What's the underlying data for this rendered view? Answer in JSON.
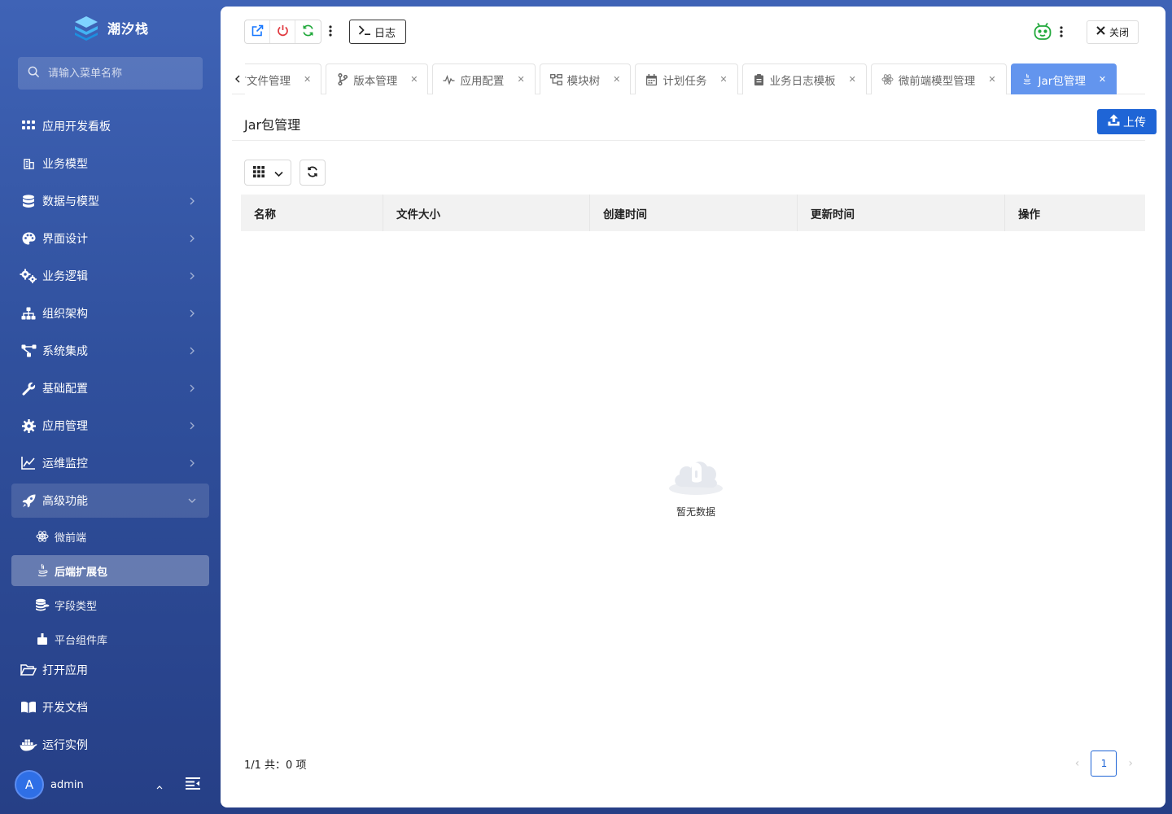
{
  "app": {
    "name": "潮汐栈"
  },
  "sidebar": {
    "search_placeholder": "请输入菜单名称",
    "items": [
      {
        "label": "应用开发看板",
        "icon": "grid-icon",
        "has_children": false
      },
      {
        "label": "业务模型",
        "icon": "building-icon",
        "has_children": false
      },
      {
        "label": "数据与模型",
        "icon": "database-icon",
        "has_children": true
      },
      {
        "label": "界面设计",
        "icon": "palette-icon",
        "has_children": true
      },
      {
        "label": "业务逻辑",
        "icon": "gears-icon",
        "has_children": true
      },
      {
        "label": "组织架构",
        "icon": "org-chart-icon",
        "has_children": true
      },
      {
        "label": "系统集成",
        "icon": "network-icon",
        "has_children": true
      },
      {
        "label": "基础配置",
        "icon": "wrench-icon",
        "has_children": true
      },
      {
        "label": "应用管理",
        "icon": "gear-icon",
        "has_children": true
      },
      {
        "label": "运维监控",
        "icon": "line-chart-icon",
        "has_children": true
      },
      {
        "label": "高级功能",
        "icon": "rocket-icon",
        "has_children": true,
        "expanded": true
      }
    ],
    "sub_items": [
      {
        "label": "微前端",
        "icon": "atom-icon"
      },
      {
        "label": "后端扩展包",
        "icon": "java-icon",
        "active": true
      },
      {
        "label": "字段类型",
        "icon": "coins-icon"
      },
      {
        "label": "平台组件库",
        "icon": "puzzle-icon"
      }
    ],
    "bottom_items": [
      {
        "label": "打开应用",
        "icon": "folder-open-icon"
      },
      {
        "label": "开发文档",
        "icon": "book-icon"
      },
      {
        "label": "运行实例",
        "icon": "docker-icon"
      }
    ],
    "user": {
      "avatar_letter": "A",
      "name": "admin"
    }
  },
  "toolbar": {
    "log_label": "日志",
    "close_label": "关闭"
  },
  "tabs": [
    {
      "label": "语言文件管理",
      "icon": "file-icon"
    },
    {
      "label": "版本管理",
      "icon": "branch-icon"
    },
    {
      "label": "应用配置",
      "icon": "pulse-icon"
    },
    {
      "label": "模块树",
      "icon": "tree-icon"
    },
    {
      "label": "计划任务",
      "icon": "calendar-icon"
    },
    {
      "label": "业务日志模板",
      "icon": "clipboard-icon"
    },
    {
      "label": "微前端模型管理",
      "icon": "atom-icon"
    },
    {
      "label": "Jar包管理",
      "icon": "java-icon",
      "active": true
    }
  ],
  "page": {
    "title": "Jar包管理",
    "upload_label": "上传",
    "columns": [
      "名称",
      "文件大小",
      "创建时间",
      "更新时间",
      "操作"
    ],
    "empty_text": "暂无数据",
    "footer": "1/1 共：0 项",
    "current_page": "1"
  },
  "colors": {
    "accent": "#1f65d6",
    "active_tab": "#6395ee",
    "sidebar_top": "#3f63b6",
    "sidebar_bottom": "#263f86"
  }
}
